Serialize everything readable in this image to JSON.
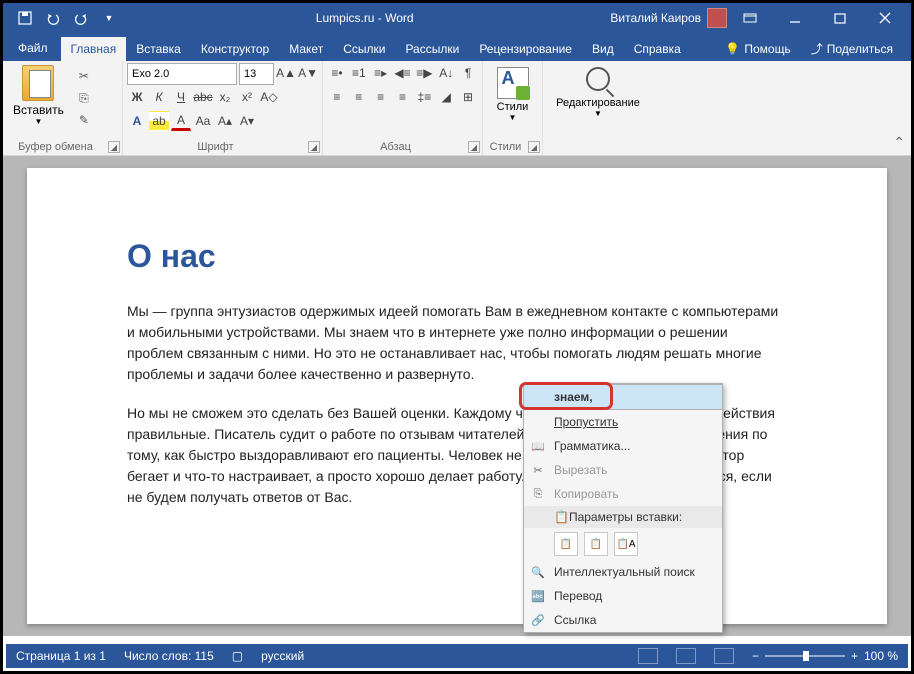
{
  "window": {
    "title": "Lumpics.ru - Word",
    "user_name": "Виталий Каиров"
  },
  "tabs": {
    "file": "Файл",
    "home": "Главная",
    "insert": "Вставка",
    "design": "Конструктор",
    "layout": "Макет",
    "references": "Ссылки",
    "mailings": "Рассылки",
    "review": "Рецензирование",
    "view": "Вид",
    "help": "Справка",
    "q_help": "Помощь",
    "share": "Поделиться"
  },
  "ribbon": {
    "clipboard": {
      "label": "Буфер обмена",
      "paste": "Вставить"
    },
    "font": {
      "label": "Шрифт",
      "name": "Exo 2.0",
      "size": "13"
    },
    "paragraph": {
      "label": "Абзац"
    },
    "styles": {
      "label": "Стили",
      "btn": "Стили"
    },
    "editing": {
      "label": "Редактирование",
      "btn": "Редактирование"
    }
  },
  "document": {
    "heading": "О нас",
    "p1": "Мы — группа энтузиастов одержимых идеей помогать Вам в ежедневном контакте с компьютерами и мобильными устройствами. Мы знаем что в интернете уже полно информации о решении проблем связанным с ними. Но это не останавливает нас, чтобы помогать людям решать многие проблемы и задачи более качественно и развернуто.",
    "p2": "Но мы не сможем это сделать без Вашей оценки. Каждому человеку важно знать, что его действия правильные. Писатель судит о работе по отзывам читателей. Доктор судит о качестве лечения по тому, как быстро выздоравливают его пациенты. Человек не понимает, почему администратор бегает и что-то настраивает, а просто хорошо делает работу. Так и мы не можем улучшаться, если не будем получать ответов от Вас."
  },
  "context_menu": {
    "suggestion": "знаем,",
    "skip": "Пропустить",
    "grammar": "Грамматика...",
    "cut": "Вырезать",
    "copy": "Копировать",
    "paste_header": "Параметры вставки:",
    "smart_lookup": "Интеллектуальный поиск",
    "translate": "Перевод",
    "link": "Ссылка"
  },
  "status": {
    "page": "Страница 1 из 1",
    "words": "Число слов: 115",
    "lang": "русский",
    "zoom": "100 %"
  }
}
